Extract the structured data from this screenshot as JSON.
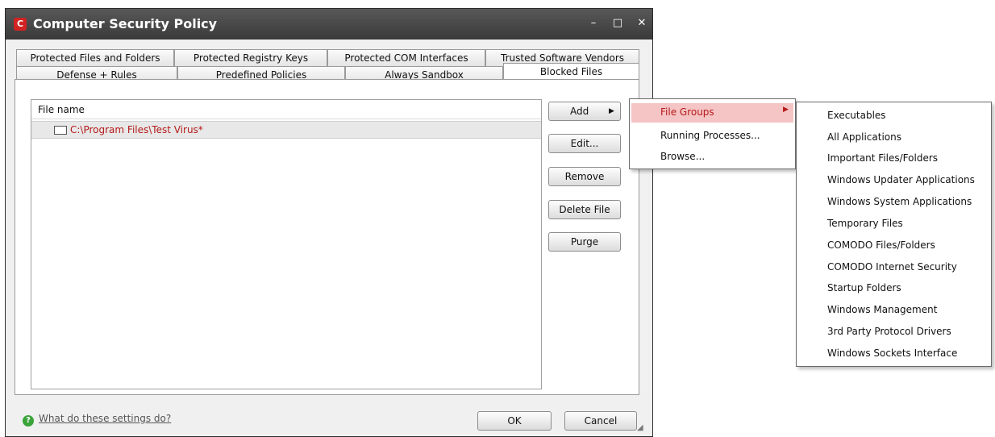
{
  "window": {
    "title": "Computer Security Policy",
    "icon_letter": "C",
    "minimize": "–",
    "maximize": "□",
    "close": "✕"
  },
  "tabs": {
    "row1": [
      "Protected Files and Folders",
      "Protected Registry Keys",
      "Protected COM Interfaces",
      "Trusted Software Vendors"
    ],
    "row2": [
      "Defense + Rules",
      "Predefined Policies",
      "Always Sandbox",
      "Blocked Files"
    ],
    "active": "Blocked Files"
  },
  "list": {
    "header": "File name",
    "rows": [
      "C:\\Program Files\\Test Virus*"
    ]
  },
  "buttons": {
    "add": "Add",
    "add_arrow": "▶",
    "edit": "Edit...",
    "remove": "Remove",
    "delete_file": "Delete File",
    "purge": "Purge",
    "ok": "OK",
    "cancel": "Cancel"
  },
  "help": {
    "icon": "?",
    "link": "What do these settings do?"
  },
  "add_menu": {
    "items": [
      "File Groups",
      "Running Processes...",
      "Browse..."
    ],
    "submenu_arrow": "▶"
  },
  "file_groups_menu": {
    "items": [
      "Executables",
      "All Applications",
      "Important Files/Folders",
      "Windows Updater Applications",
      "Windows System Applications",
      "Temporary Files",
      "COMODO Files/Folders",
      "COMODO Internet Security",
      "Startup Folders",
      "Windows Management",
      "3rd Party Protocol Drivers",
      "Windows Sockets Interface"
    ]
  },
  "colors": {
    "titlebar": "#3a3a3a",
    "accent_red": "#b51a1a",
    "menu_highlight": "#f5c4c4"
  }
}
